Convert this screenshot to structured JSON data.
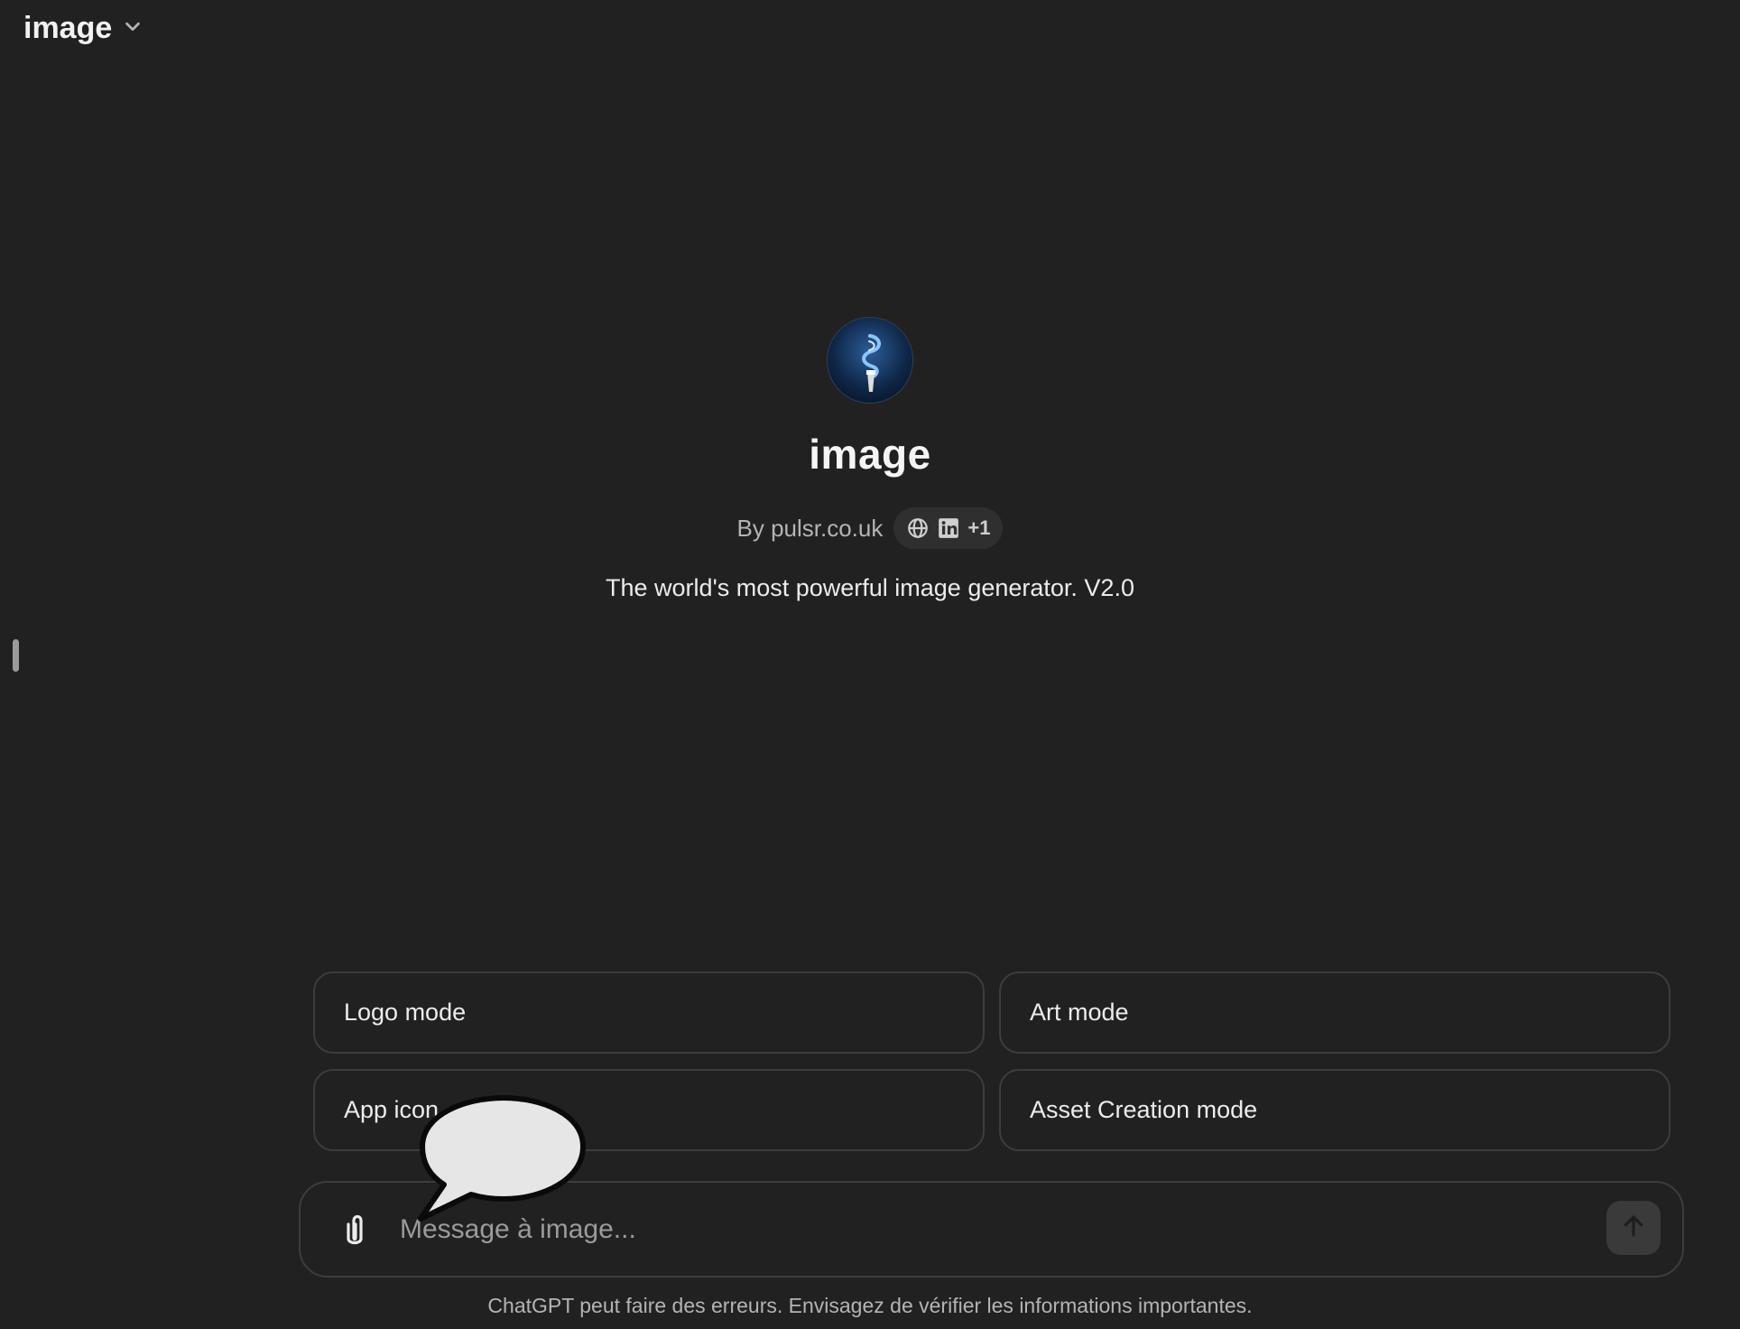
{
  "header": {
    "model_title": "image"
  },
  "gpt": {
    "name": "image",
    "author": "By pulsr.co.uk",
    "links_more": "+1",
    "description": "The world's most powerful image generator. V2.0"
  },
  "starters": [
    {
      "label": "Logo mode"
    },
    {
      "label": "Art mode"
    },
    {
      "label": "App icon"
    },
    {
      "label": "Asset Creation mode"
    }
  ],
  "composer": {
    "placeholder": "Message à image..."
  },
  "footer": {
    "disclaimer": "ChatGPT peut faire des erreurs. Envisagez de vérifier les informations importantes."
  },
  "colors": {
    "background": "#212121",
    "border": "#3d3d3d",
    "text": "#ececec",
    "muted": "#b4b4b4"
  }
}
